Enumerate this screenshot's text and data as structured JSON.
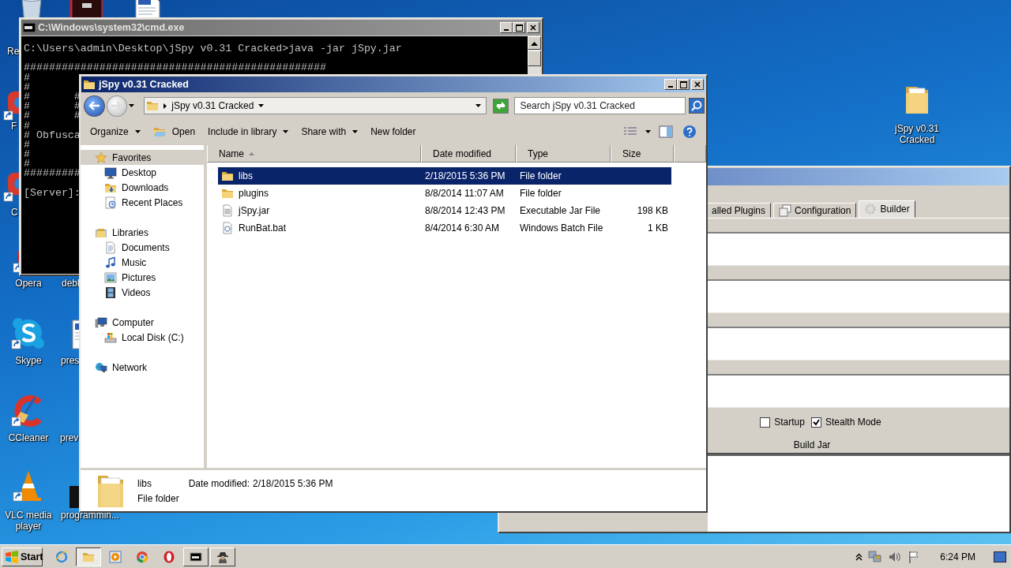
{
  "desktop_icons": [
    {
      "label": "Re",
      "kind": "recycle"
    },
    {
      "kind": "redapp"
    },
    {
      "kind": "doc"
    },
    {
      "label": "F",
      "kind": "app"
    },
    {
      "label": "C",
      "kind": "app"
    },
    {
      "label": "Opera",
      "kind": "opera"
    },
    {
      "label": "debl"
    },
    {
      "label": "Skype",
      "kind": "skype"
    },
    {
      "label": "pres",
      "kind": "doc"
    },
    {
      "label": "CCleaner",
      "kind": "ccleaner"
    },
    {
      "label": "prev"
    },
    {
      "label": "VLC media player",
      "kind": "vlc"
    },
    {
      "label": "programmin...",
      "kind": "program"
    },
    {
      "label": "jSpy v0.31 Cracked",
      "kind": "folder"
    }
  ],
  "jspy_window": {
    "tabs": [
      {
        "label": "alled Plugins",
        "selected": false
      },
      {
        "label": "Configuration",
        "selected": false
      },
      {
        "label": "Builder",
        "selected": true
      }
    ],
    "options": [
      {
        "label": "Startup",
        "checked": false
      },
      {
        "label": "Stealth Mode",
        "checked": true
      }
    ],
    "build_button": "Build Jar"
  },
  "cmd_window": {
    "title": "C:\\Windows\\system32\\cmd.exe",
    "active": false,
    "command": "C:\\Users\\admin\\Desktop\\jSpy v0.31 Cracked>java -jar jSpy.jar",
    "output": [
      "################################################",
      "#",
      "#",
      "#       #",
      "#       #",
      "#       #",
      "#",
      "# Obfusca",
      "#",
      "#",
      "#",
      "#########"
    ],
    "prompt": "[Server]:"
  },
  "explorer_window": {
    "title": "jSpy v0.31 Cracked",
    "active": true,
    "breadcrumb": "jSpy v0.31 Cracked",
    "search": {
      "placeholder": "Search jSpy v0.31 Cracked"
    },
    "toolbar": [
      {
        "label": "Organize",
        "kind": "menu"
      },
      {
        "label": "Open",
        "kind": "icon"
      },
      {
        "label": "Include in library",
        "kind": "menu"
      },
      {
        "label": "Share with",
        "kind": "menu"
      },
      {
        "label": "New folder",
        "kind": "plain"
      }
    ],
    "nav": [
      {
        "label": "Favorites",
        "selected": true,
        "children": [
          {
            "label": "Desktop",
            "selected": false
          },
          {
            "label": "Downloads",
            "selected": false
          },
          {
            "label": "Recent Places",
            "selected": false
          }
        ]
      },
      {
        "label": "Libraries",
        "selected": false,
        "children": [
          {
            "label": "Documents",
            "selected": false
          },
          {
            "label": "Music",
            "selected": false
          },
          {
            "label": "Pictures",
            "selected": false
          },
          {
            "label": "Videos",
            "selected": false
          }
        ]
      },
      {
        "label": "Computer",
        "selected": false,
        "children": [
          {
            "label": "Local Disk (C:)",
            "selected": false
          }
        ]
      },
      {
        "label": "Network",
        "selected": false
      }
    ],
    "columns": [
      {
        "label": "Name",
        "sorted": true
      },
      {
        "label": "Date modified",
        "sorted": false
      },
      {
        "label": "Type",
        "sorted": false
      },
      {
        "label": "Size",
        "sorted": false
      }
    ],
    "files": [
      {
        "name": "libs",
        "date": "2/18/2015 5:36 PM",
        "type": "File folder",
        "kind": "folder",
        "selected": true
      },
      {
        "name": "plugins",
        "date": "8/8/2014 11:07 AM",
        "type": "File folder",
        "kind": "folder",
        "selected": false
      },
      {
        "name": "jSpy.jar",
        "date": "8/8/2014 12:43 PM",
        "type": "Executable Jar File",
        "size": "198 KB",
        "kind": "jar",
        "selected": false
      },
      {
        "name": "RunBat.bat",
        "date": "8/4/2014 6:30 AM",
        "type": "Windows Batch File",
        "size": "1 KB",
        "kind": "batch",
        "selected": false
      }
    ],
    "details": {
      "name": "libs",
      "date_label": "Date modified:",
      "date": "2/18/2015 5:36 PM",
      "type": "File folder"
    }
  },
  "taskbar": {
    "start": "Start",
    "items": [
      {
        "kind": "launcher",
        "selected": false
      },
      {
        "kind": "window",
        "selected": true
      },
      {
        "kind": "launcher",
        "selected": false
      },
      {
        "kind": "launcher",
        "selected": false
      },
      {
        "kind": "launcher",
        "selected": false
      },
      {
        "kind": "window",
        "selected": false
      },
      {
        "kind": "window",
        "selected": false
      }
    ],
    "clock": "6:24 PM"
  }
}
